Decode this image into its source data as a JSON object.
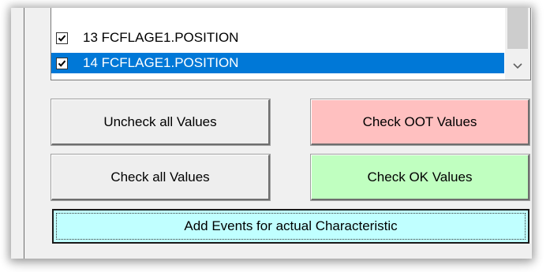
{
  "list": {
    "items": [
      {
        "number": "13",
        "label": "FCFLAGE1.POSITION",
        "checked": true,
        "selected": false
      },
      {
        "number": "14",
        "label": "FCFLAGE1.POSITION",
        "checked": true,
        "selected": true
      }
    ],
    "row_13_text": "13  FCFLAGE1.POSITION",
    "row_14_text": "14  FCFLAGE1.POSITION",
    "scroll_icon": "chevron-down-icon"
  },
  "buttons": {
    "uncheck_all": "Uncheck all Values",
    "check_oot": "Check OOT Values",
    "check_all": "Check all Values",
    "check_ok": "Check OK Values",
    "add_events": "Add Events for actual Characteristic"
  },
  "colors": {
    "selection": "#0078d7",
    "oot_button": "#ffc0c0",
    "ok_button": "#c0ffc0",
    "add_events_button": "#c0ffff",
    "neutral_button": "#eeeeee"
  }
}
